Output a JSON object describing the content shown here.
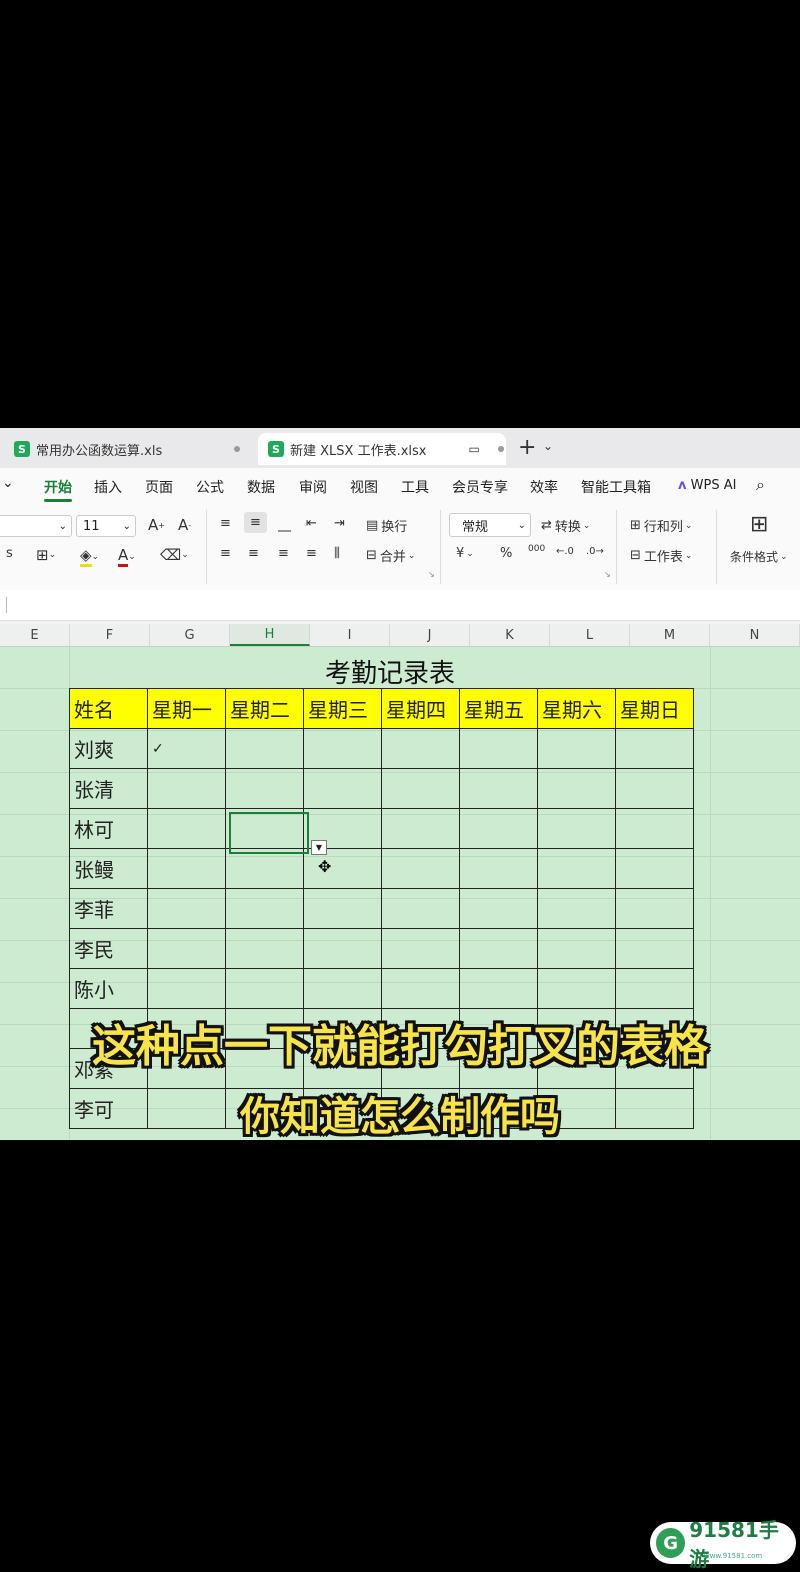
{
  "tabs": [
    {
      "label": "常用办公函数运算.xls",
      "logo": "S"
    },
    {
      "label": "新建 XLSX 工作表.xlsx",
      "logo": "S"
    }
  ],
  "menu": [
    "开始",
    "插入",
    "页面",
    "公式",
    "数据",
    "审阅",
    "视图",
    "工具",
    "会员专享",
    "效率",
    "智能工具箱"
  ],
  "wps_ai": "WPS AI",
  "ribbon": {
    "font_size": "11",
    "wrap": "换行",
    "merge": "合并",
    "number_format": "常规",
    "convert": "转换",
    "rows_cols": "行和列",
    "worksheet": "工作表",
    "cond_format": "条件格式",
    "currency": "¥",
    "percent": "%",
    "thousands": "000"
  },
  "columns": [
    "E",
    "F",
    "G",
    "H",
    "I",
    "J",
    "K",
    "L",
    "M",
    "N"
  ],
  "sheet": {
    "title": "考勤记录表",
    "header": [
      "姓名",
      "星期一",
      "星期二",
      "星期三",
      "星期四",
      "星期五",
      "星期六",
      "星期日"
    ],
    "rows": [
      {
        "name": "刘爽",
        "mon": "✓"
      },
      {
        "name": "张清",
        "mon": ""
      },
      {
        "name": "林可",
        "mon": ""
      },
      {
        "name": "张鳗",
        "mon": ""
      },
      {
        "name": "李菲",
        "mon": ""
      },
      {
        "name": "李民",
        "mon": ""
      },
      {
        "name": "陈小",
        "mon": ""
      },
      {
        "name": "",
        "mon": ""
      },
      {
        "name": "邓紫",
        "mon": ""
      },
      {
        "name": "李可",
        "mon": ""
      }
    ]
  },
  "captions": {
    "line1": "这种点一下就能打勾打叉的表格",
    "line2": "你知道怎么制作吗"
  },
  "watermark": {
    "text": "91581手游",
    "url": "www.91581.com"
  }
}
